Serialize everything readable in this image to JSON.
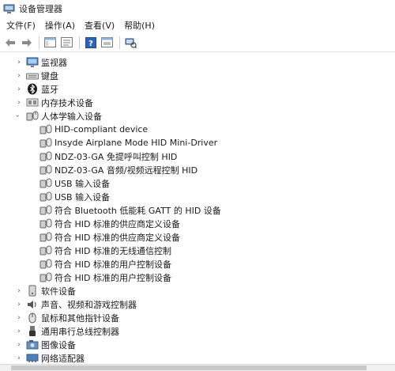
{
  "window": {
    "title": "设备管理器"
  },
  "menu": [
    {
      "label": "文件(F)"
    },
    {
      "label": "操作(A)"
    },
    {
      "label": "查看(V)"
    },
    {
      "label": "帮助(H)"
    }
  ],
  "toolbar": [
    "back-icon",
    "forward-icon",
    "show-hide-tree-icon",
    "properties-icon",
    "help-icon",
    "view-icon",
    "scan-hardware-icon"
  ],
  "tree": {
    "categories_top": [
      {
        "label": "监视器",
        "icon": "monitor-icon"
      },
      {
        "label": "键盘",
        "icon": "keyboard-icon"
      },
      {
        "label": "蓝牙",
        "icon": "bluetooth-icon"
      },
      {
        "label": "内存技术设备",
        "icon": "memory-icon"
      }
    ],
    "expanded": {
      "label": "人体学输入设备",
      "icon": "hid-icon",
      "children": [
        "HID-compliant device",
        "Insyde Airplane Mode HID Mini-Driver",
        "NDZ-03-GA 免提呼叫控制 HID",
        "NDZ-03-GA 音频/视频远程控制 HID",
        "USB 输入设备",
        "USB 输入设备",
        "符合 Bluetooth 低能耗 GATT 的 HID 设备",
        "符合 HID 标准的供应商定义设备",
        "符合 HID 标准的供应商定义设备",
        "符合 HID 标准的无线通信控制",
        "符合 HID 标准的用户控制设备",
        "符合 HID 标准的用户控制设备"
      ]
    },
    "categories_bottom": [
      {
        "label": "软件设备",
        "icon": "software-device-icon"
      },
      {
        "label": "声音、视频和游戏控制器",
        "icon": "speaker-icon"
      },
      {
        "label": "鼠标和其他指针设备",
        "icon": "mouse-icon"
      },
      {
        "label": "通用串行总线控制器",
        "icon": "usb-icon"
      },
      {
        "label": "图像设备",
        "icon": "camera-icon"
      },
      {
        "label": "网络适配器",
        "icon": "network-adapter-icon"
      }
    ]
  }
}
